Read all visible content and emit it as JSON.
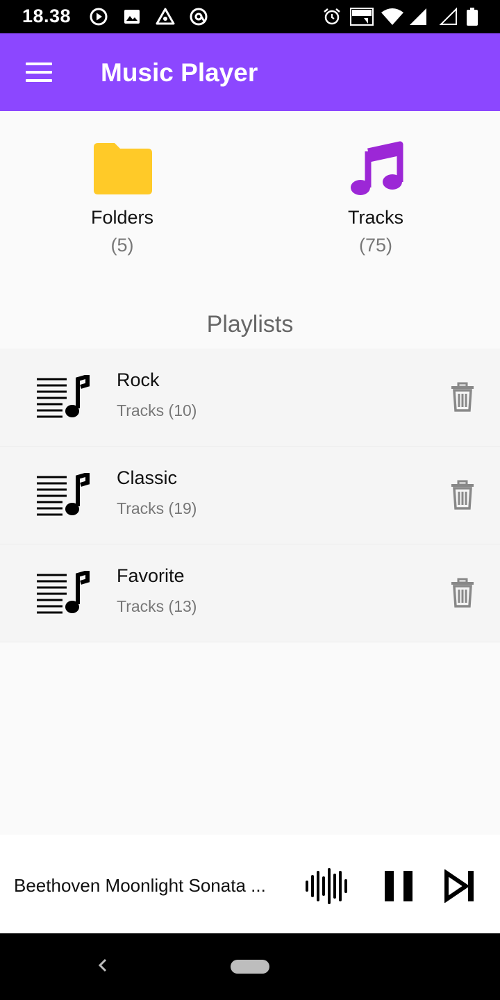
{
  "status_bar": {
    "time": "18.38",
    "left_icons": [
      "play-circle-icon",
      "image-icon",
      "triangle-app-icon",
      "at-circle-icon"
    ],
    "right_icons": [
      "alarm-icon",
      "volte-icon",
      "wifi-icon",
      "signal-icon",
      "signal-empty-icon",
      "battery-icon"
    ]
  },
  "app_bar": {
    "title": "Music Player",
    "menu_icon": "hamburger-menu-icon",
    "color": "#8c47ff"
  },
  "categories": [
    {
      "label": "Folders",
      "count": "(5)",
      "icon": "folder-icon",
      "icon_color": "#ffca28"
    },
    {
      "label": "Tracks",
      "count": "(75)",
      "icon": "music-note-icon",
      "icon_color": "#9c27d6"
    }
  ],
  "playlists": {
    "title": "Playlists",
    "items": [
      {
        "name": "Rock",
        "count": "Tracks (10)",
        "icon": "playlist-music-icon",
        "action_icon": "trash-icon"
      },
      {
        "name": "Classic",
        "count": "Tracks (19)",
        "icon": "playlist-music-icon",
        "action_icon": "trash-icon"
      },
      {
        "name": "Favorite",
        "count": "Tracks (13)",
        "icon": "playlist-music-icon",
        "action_icon": "trash-icon"
      }
    ]
  },
  "now_playing": {
    "title": "Beethoven Moonlight Sonata ...",
    "icons": [
      "waveform-icon",
      "pause-icon",
      "skip-next-icon"
    ]
  },
  "nav_bar": {
    "icons": [
      "back-icon",
      "home-pill-icon"
    ]
  }
}
